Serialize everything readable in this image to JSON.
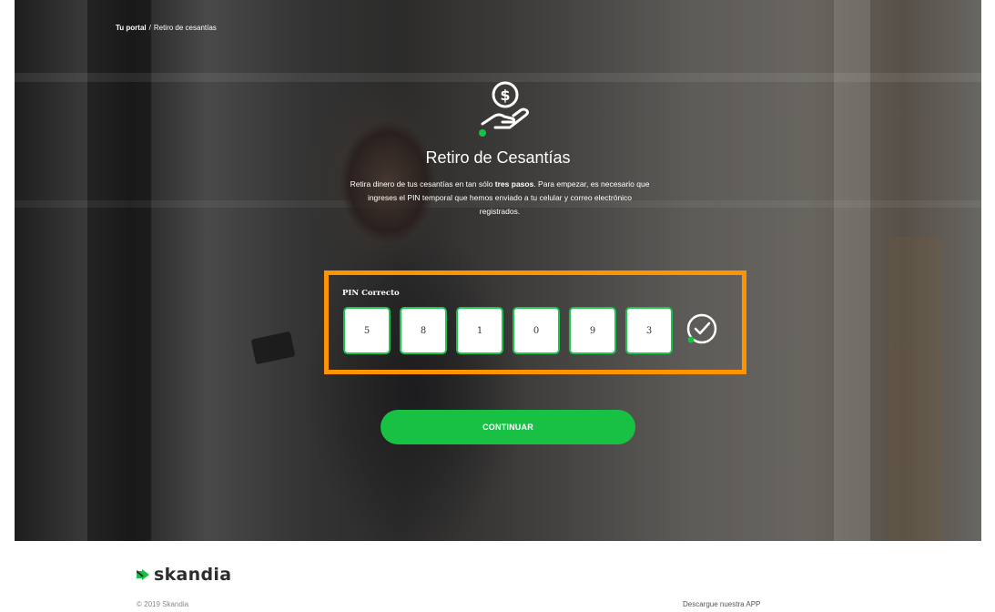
{
  "breadcrumb": {
    "home": "Tu portal",
    "separator": "/",
    "current": "Retiro de cesantías"
  },
  "hero": {
    "title": "Retiro de Cesantías",
    "description_part1": "Retira dinero de tus cesantías en tan sólo ",
    "description_bold": "tres pasos",
    "description_part2": ". Para empezar, es necesario que ingreses el PIN temporal que hemos enviado a tu celular y correo electrónico registrados."
  },
  "pin": {
    "label": "PIN Correcto",
    "digits": [
      "5",
      "8",
      "1",
      "0",
      "9",
      "3"
    ],
    "status_icon": "check-circle-icon"
  },
  "actions": {
    "continue_label": "CONTINUAR"
  },
  "footer": {
    "brand": "skandia",
    "copyright": "© 2019 Skandia",
    "download_app": "Descargue nuestra APP"
  },
  "colors": {
    "accent_green": "#18c144",
    "highlight_orange": "#ff9400"
  }
}
